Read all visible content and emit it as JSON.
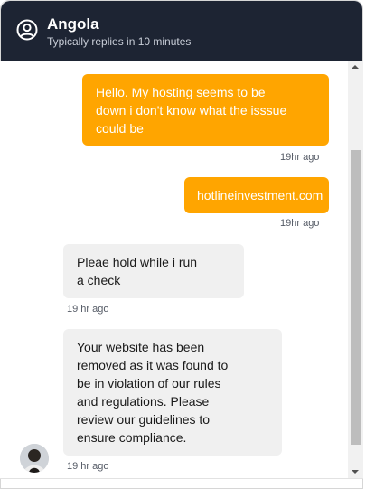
{
  "header": {
    "agent_name": "Angola",
    "status": "Typically replies in 10 minutes",
    "icon": "user-circle-icon",
    "background_color": "#1d2433"
  },
  "messages": [
    {
      "direction": "outgoing",
      "text_lines": [
        "Hello. My hosting seems to be",
        "down i don't know what the isssue",
        "could be"
      ],
      "time": "19hr ago"
    },
    {
      "direction": "outgoing",
      "text_lines": [
        "hotlineinvestment.com"
      ],
      "time": "19hr ago"
    },
    {
      "direction": "incoming",
      "text_lines": [
        "Pleae hold while i run",
        "a check"
      ],
      "time": "19 hr ago"
    },
    {
      "direction": "incoming",
      "text_lines": [
        "Your website has been",
        "removed as it was found to",
        "be in violation of our rules",
        "and regulations. Please",
        "review our guidelines to",
        "ensure compliance."
      ],
      "time": "19 hr ago"
    }
  ],
  "colors": {
    "outgoing_bubble": "#ffa500",
    "incoming_bubble": "#f0f0f0"
  }
}
